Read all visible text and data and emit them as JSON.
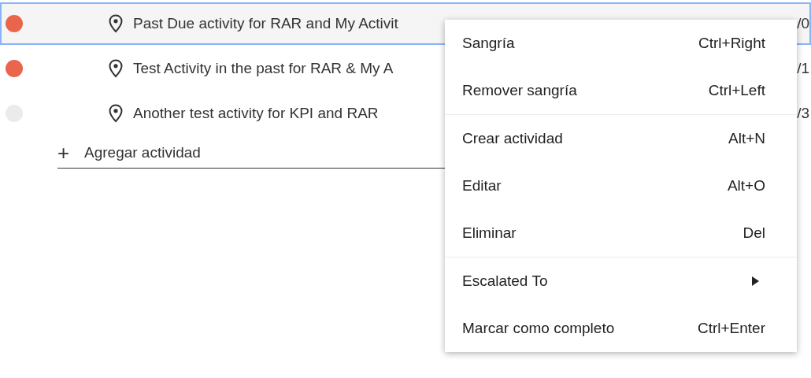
{
  "activities": [
    {
      "title": "Past Due activity for RAR and My Activit",
      "date_fragment": "/0",
      "color": "#e9664d",
      "selected": true
    },
    {
      "title": "Test Activity in the past for RAR & My A",
      "date_fragment": "/1",
      "color": "#e9664d",
      "selected": false
    },
    {
      "title": "Another test activity for KPI and RAR",
      "date_fragment": "/3",
      "color": "#ebebeb",
      "selected": false
    }
  ],
  "add_activity": {
    "icon": "+",
    "label": "Agregar actividad"
  },
  "context_menu": {
    "groups": [
      [
        {
          "kind": "action",
          "label": "Sangría",
          "shortcut": "Ctrl+Right"
        },
        {
          "kind": "action",
          "label": "Remover sangría",
          "shortcut": "Ctrl+Left"
        }
      ],
      [
        {
          "kind": "action",
          "label": "Crear actividad",
          "shortcut": "Alt+N"
        },
        {
          "kind": "action",
          "label": "Editar",
          "shortcut": "Alt+O"
        },
        {
          "kind": "action",
          "label": "Eliminar",
          "shortcut": "Del"
        }
      ],
      [
        {
          "kind": "submenu",
          "label": "Escalated To"
        },
        {
          "kind": "action",
          "label": "Marcar como completo",
          "shortcut": "Ctrl+Enter"
        }
      ]
    ]
  }
}
